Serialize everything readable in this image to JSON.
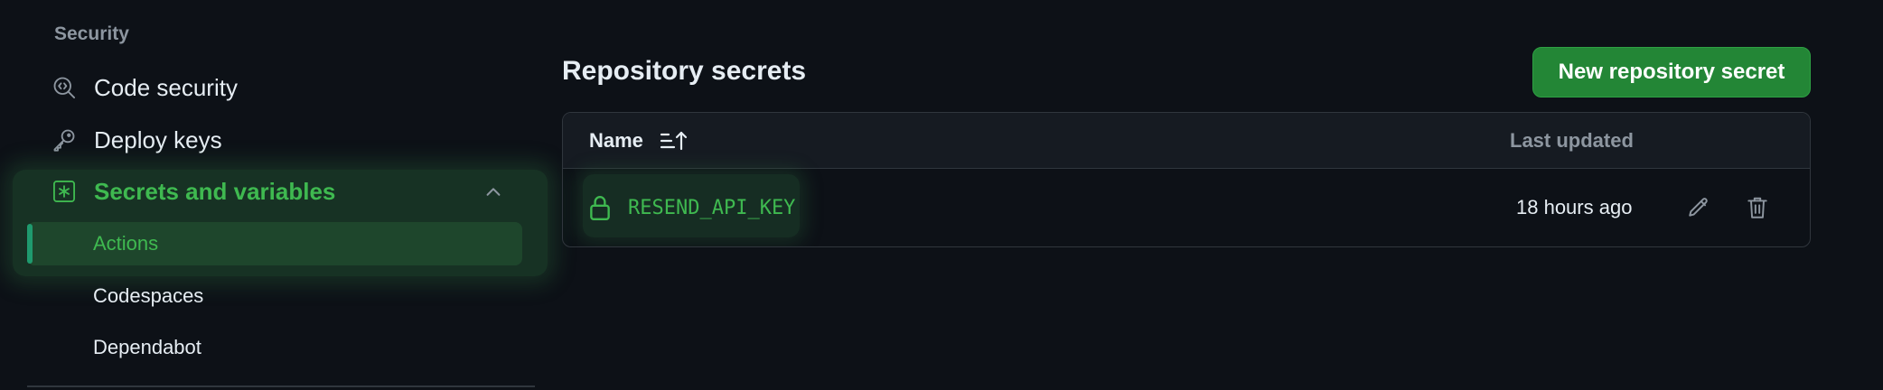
{
  "sidebar": {
    "section_heading": "Security",
    "items": [
      {
        "label": "Code security",
        "icon": "code-security-icon"
      },
      {
        "label": "Deploy keys",
        "icon": "key-icon"
      },
      {
        "label": "Secrets and variables",
        "icon": "asterisk-square-icon",
        "expanded": true
      }
    ],
    "sub_items": [
      {
        "label": "Actions",
        "active": true
      },
      {
        "label": "Codespaces"
      },
      {
        "label": "Dependabot"
      }
    ]
  },
  "main": {
    "title": "Repository secrets",
    "new_button_label": "New repository secret",
    "table": {
      "columns": {
        "name": "Name",
        "last_updated": "Last updated"
      },
      "rows": [
        {
          "name": "RESEND_API_KEY",
          "last_updated": "18 hours ago"
        }
      ]
    }
  },
  "colors": {
    "background": "#0d1117",
    "accent_green": "#3fb950",
    "button_green": "#238636",
    "muted_text": "#8d96a0"
  }
}
